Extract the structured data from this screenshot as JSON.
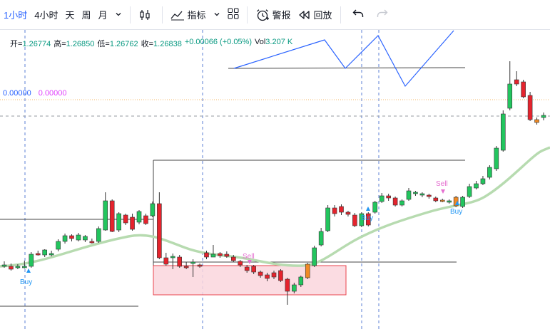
{
  "toolbar": {
    "timeframes": [
      "1小时",
      "4小时",
      "天",
      "周",
      "月"
    ],
    "active_timeframe": "1小时",
    "indicators_label": "指标",
    "alert_label": "警报",
    "replay_label": "回放"
  },
  "ohlc": {
    "open_label": "开=",
    "open": "1.26774",
    "high_label": "高=",
    "high": "1.26850",
    "low_label": "低=",
    "low": "1.26762",
    "close_label": "收=",
    "close": "1.26838",
    "change": "+0.00066 (+0.05%)",
    "vol_label": "Vol",
    "vol": "3.207 K"
  },
  "indicator_values": [
    "0.00000",
    "0.00000"
  ],
  "colors": {
    "up": "#22c55e",
    "down": "#e5232d",
    "signal": "#f08a24",
    "ma": "#b7dbb0",
    "zigzag": "#2962ff",
    "box_fill": "#fbd6de",
    "box_stroke": "#e5232d",
    "buy": "#2196f3",
    "sell": "#e56fd0"
  },
  "chart_data": {
    "type": "candlestick",
    "ohlc_index_step": 1,
    "candles": [
      [
        372,
        374,
        367,
        376,
        "u"
      ],
      [
        374,
        378,
        370,
        380,
        "d"
      ],
      [
        374,
        376,
        371,
        378,
        "u"
      ],
      [
        374,
        375,
        366,
        377,
        "u"
      ],
      [
        357,
        374,
        354,
        376,
        "u"
      ],
      [
        357,
        356,
        352,
        359,
        "d"
      ],
      [
        358,
        351,
        350,
        361,
        "u"
      ],
      [
        356,
        357,
        352,
        360,
        "u"
      ],
      [
        350,
        339,
        336,
        353,
        "u"
      ],
      [
        339,
        331,
        328,
        342,
        "u"
      ],
      [
        331,
        335,
        329,
        339,
        "d"
      ],
      [
        337,
        330,
        327,
        339,
        "u"
      ],
      [
        337,
        332,
        330,
        340,
        "u"
      ],
      [
        339,
        340,
        335,
        342,
        "d"
      ],
      [
        339,
        321,
        318,
        341,
        "u"
      ],
      [
        323,
        282,
        270,
        324,
        "u"
      ],
      [
        282,
        325,
        280,
        326,
        "d"
      ],
      [
        323,
        300,
        298,
        326,
        "u"
      ],
      [
        302,
        313,
        300,
        316,
        "d"
      ],
      [
        305,
        322,
        300,
        324,
        "d"
      ],
      [
        312,
        297,
        295,
        315,
        "u"
      ],
      [
        303,
        314,
        300,
        316,
        "d"
      ],
      [
        303,
        286,
        283,
        305,
        "u"
      ],
      [
        286,
        362,
        270,
        364,
        "d"
      ],
      [
        362,
        371,
        355,
        373,
        "d"
      ],
      [
        362,
        360,
        356,
        378,
        "u"
      ],
      [
        361,
        374,
        358,
        376,
        "d"
      ],
      [
        374,
        375,
        368,
        378,
        "d"
      ],
      [
        368,
        368,
        364,
        389,
        "u"
      ],
      [
        372,
        374,
        370,
        376,
        "d"
      ],
      [
        355,
        361,
        352,
        364,
        "d"
      ],
      [
        361,
        357,
        344,
        360,
        "u"
      ],
      [
        356,
        359,
        354,
        362,
        "d"
      ],
      [
        357,
        360,
        353,
        362,
        "d"
      ],
      [
        361,
        366,
        358,
        368,
        "d"
      ],
      [
        367,
        372,
        365,
        375,
        "d"
      ],
      [
        375,
        380,
        372,
        383,
        "d"
      ],
      [
        374,
        382,
        372,
        385,
        "d"
      ],
      [
        382,
        387,
        380,
        390,
        "d"
      ],
      [
        386,
        391,
        383,
        395,
        "d"
      ],
      [
        383,
        389,
        380,
        392,
        "d"
      ],
      [
        380,
        394,
        378,
        396,
        "d"
      ],
      [
        392,
        409,
        390,
        428,
        "d"
      ],
      [
        409,
        400,
        397,
        412,
        "u"
      ],
      [
        400,
        389,
        387,
        403,
        "u"
      ],
      [
        390,
        371,
        369,
        392,
        "s"
      ],
      [
        373,
        348,
        345,
        375,
        "u"
      ],
      [
        344,
        325,
        320,
        346,
        "u"
      ],
      [
        324,
        292,
        288,
        326,
        "u"
      ],
      [
        300,
        292,
        288,
        304,
        "d"
      ],
      [
        290,
        298,
        287,
        302,
        "d"
      ],
      [
        298,
        301,
        296,
        304,
        "d"
      ],
      [
        302,
        317,
        299,
        319,
        "d"
      ],
      [
        317,
        300,
        298,
        319,
        "u"
      ],
      [
        300,
        316,
        298,
        318,
        "d"
      ],
      [
        298,
        284,
        282,
        300,
        "u"
      ],
      [
        283,
        275,
        271,
        285,
        "u"
      ],
      [
        275,
        278,
        272,
        282,
        "d"
      ],
      [
        278,
        288,
        276,
        290,
        "d"
      ],
      [
        288,
        282,
        280,
        290,
        "u"
      ],
      [
        280,
        268,
        264,
        282,
        "u"
      ],
      [
        272,
        270,
        268,
        275,
        "u"
      ],
      [
        274,
        272,
        270,
        277,
        "u"
      ],
      [
        274,
        276,
        272,
        279,
        "d"
      ],
      [
        278,
        282,
        276,
        284,
        "d"
      ],
      [
        282,
        281,
        279,
        284,
        "s"
      ],
      [
        283,
        282,
        280,
        286,
        "u"
      ],
      [
        277,
        289,
        275,
        291,
        "s"
      ],
      [
        290,
        277,
        275,
        292,
        "u"
      ],
      [
        276,
        262,
        258,
        278,
        "u"
      ],
      [
        264,
        258,
        254,
        266,
        "u"
      ],
      [
        258,
        251,
        247,
        260,
        "u"
      ],
      [
        249,
        235,
        232,
        252,
        "u"
      ],
      [
        237,
        208,
        205,
        240,
        "u"
      ],
      [
        211,
        160,
        155,
        213,
        "u"
      ],
      [
        152,
        118,
        86,
        155,
        "u"
      ],
      [
        118,
        112,
        100,
        121,
        "d"
      ],
      [
        115,
        136,
        112,
        138,
        "d"
      ],
      [
        134,
        168,
        129,
        170,
        "d"
      ],
      [
        168,
        172,
        165,
        175,
        "s"
      ],
      [
        165,
        162,
        158,
        169,
        "u"
      ]
    ]
  }
}
